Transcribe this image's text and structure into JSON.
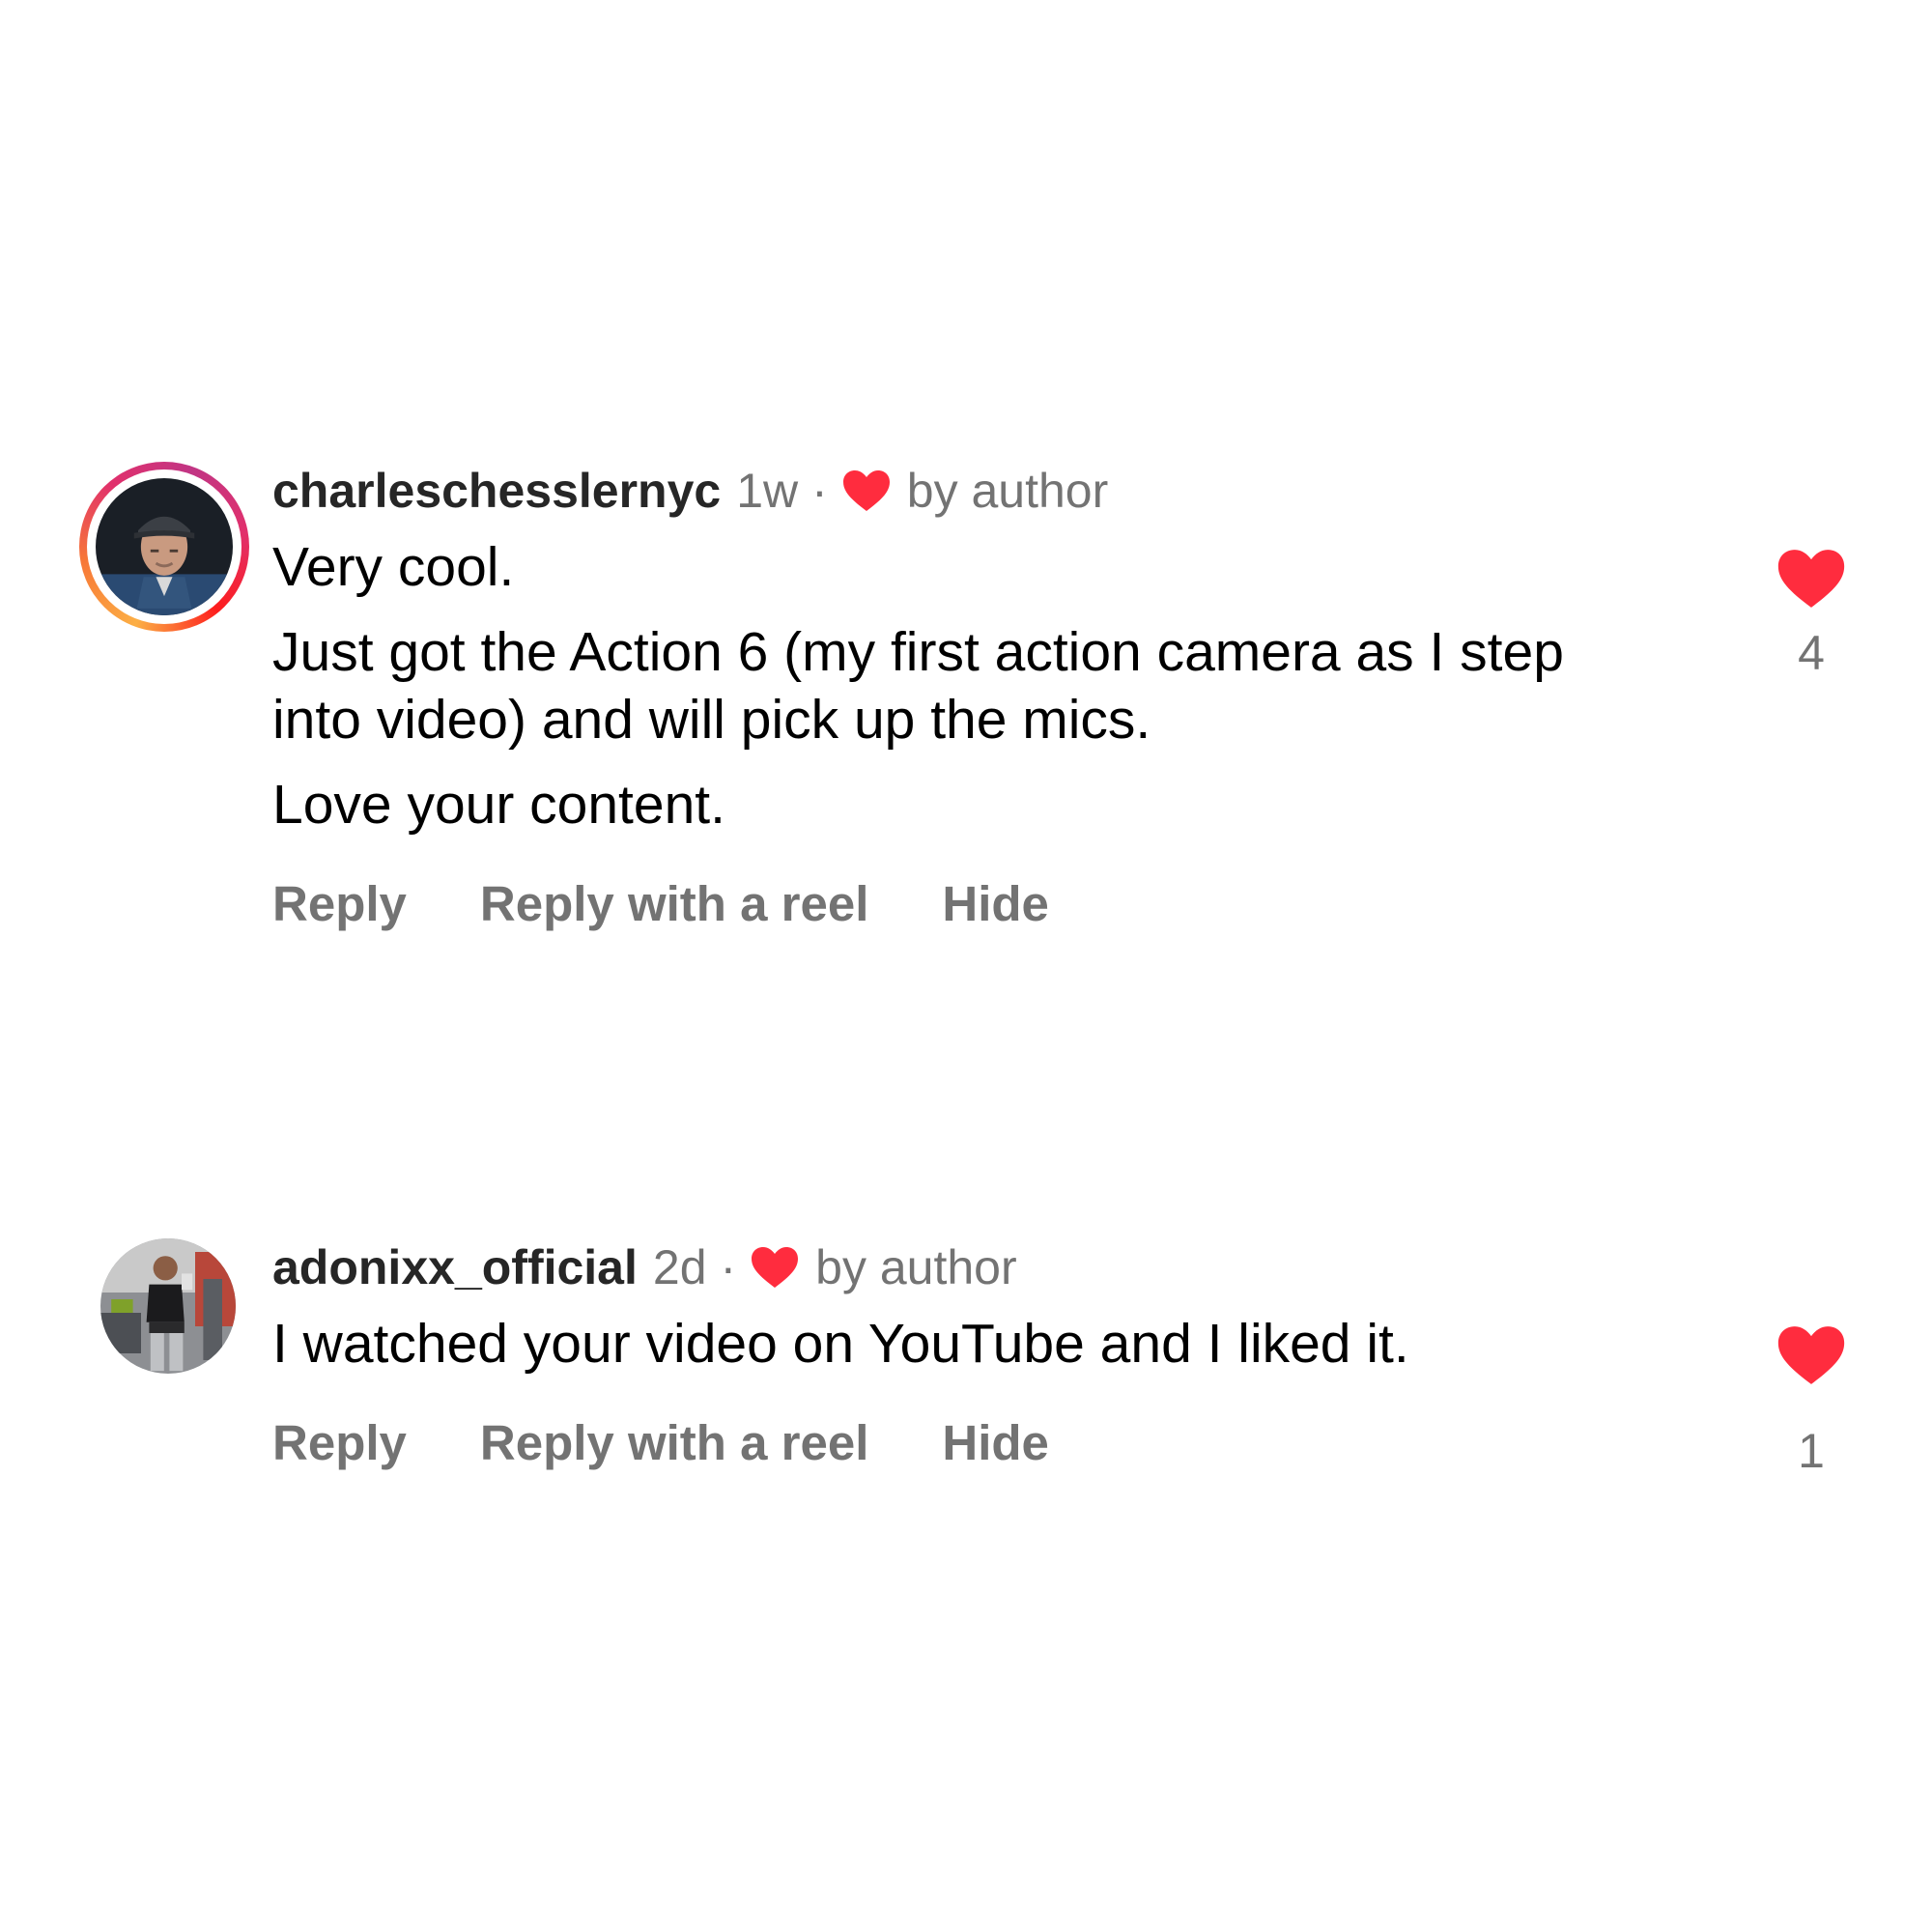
{
  "colors": {
    "heart_red": "#ff2c3e",
    "secondary_text": "#737373",
    "username_text": "#262626",
    "body_text": "#000000"
  },
  "comments": [
    {
      "username": "charleschesslernyc",
      "time": "1w",
      "separator": "·",
      "liked_by_author_icon": "heart-icon",
      "liked_by_author_label": "by author",
      "paragraphs": [
        "Very cool.",
        "Just got the Action 6 (my first action camera as I step into video) and will pick up the mics.",
        "Love your content."
      ],
      "actions": {
        "reply": "Reply",
        "reply_with_reel": "Reply with a reel",
        "hide": "Hide"
      },
      "like_icon": "heart-filled-icon",
      "like_count": "4",
      "has_story_ring": true
    },
    {
      "username": "adonixx_official",
      "time": "2d",
      "separator": "·",
      "liked_by_author_icon": "heart-icon",
      "liked_by_author_label": "by author",
      "paragraphs": [
        "I watched your video on YouTube and I liked it."
      ],
      "actions": {
        "reply": "Reply",
        "reply_with_reel": "Reply with a reel",
        "hide": "Hide"
      },
      "like_icon": "heart-filled-icon",
      "like_count": "1",
      "has_story_ring": false
    }
  ]
}
